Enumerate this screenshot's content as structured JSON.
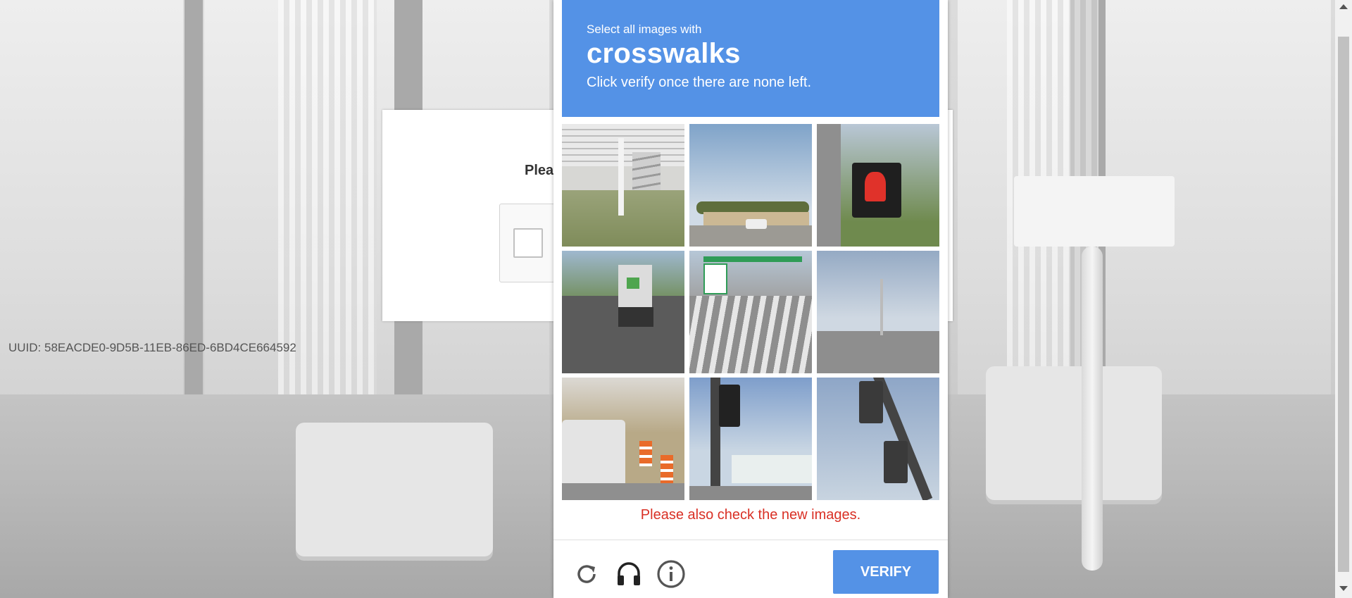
{
  "page": {
    "prompt_partial": "Plea",
    "uuid": "UUID: 58EACDE0-9D5B-11EB-86ED-6BD4CE664592"
  },
  "challenge": {
    "instruction_small": "Select all images with",
    "target_object": "crosswalks",
    "instruction_sub": "Click verify once there are none left.",
    "error_message": "Please also check the new images.",
    "verify_label": "VERIFY",
    "tiles": [
      "house steps and grass",
      "road with palm trees and parked cars",
      "pedestrian signal red hand",
      "truck on highway",
      "intersection with crosswalk and gas station",
      "rural road with cars",
      "van near traffic cones",
      "traffic light and shops",
      "traffic lights on pole"
    ],
    "colors": {
      "header_bg": "#5492e6",
      "verify_bg": "#5492e6",
      "error_text": "#d93025"
    },
    "icons": [
      "reload-icon",
      "audio-icon",
      "info-icon"
    ]
  }
}
